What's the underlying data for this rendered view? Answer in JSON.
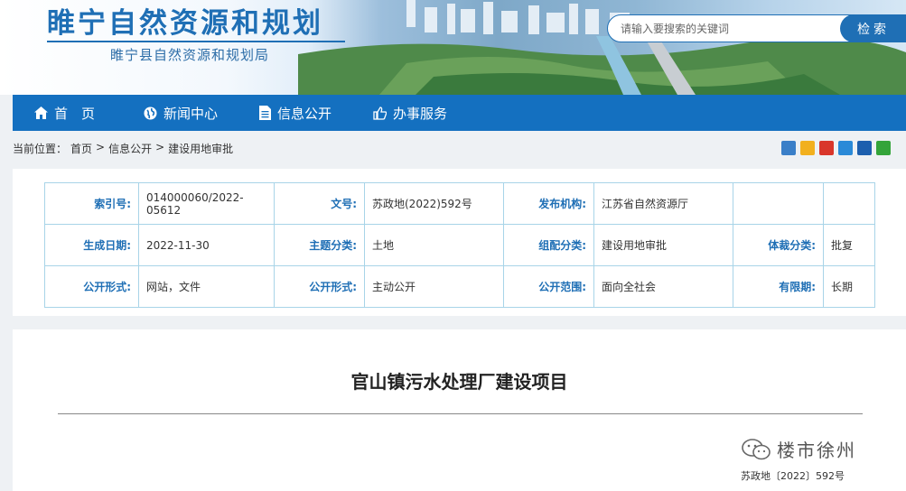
{
  "header": {
    "site_title": "睢宁自然资源和规划",
    "site_subtitle": "睢宁县自然资源和规划局",
    "search_placeholder": "请输入要搜索的关键词",
    "search_button": "检索"
  },
  "nav": [
    {
      "label": "首　页",
      "icon": "home-icon"
    },
    {
      "label": "新闻中心",
      "icon": "globe-icon"
    },
    {
      "label": "信息公开",
      "icon": "document-icon"
    },
    {
      "label": "办事服务",
      "icon": "thumbs-up-icon"
    }
  ],
  "breadcrumb": {
    "prefix": "当前位置：",
    "items": [
      "首页",
      "信息公开",
      "建设用地审批"
    ],
    "sep1": ">",
    "sep2": ">"
  },
  "share_icons": [
    {
      "name": "plus-share-icon",
      "color": "#3a7fc8"
    },
    {
      "name": "qzone-share-icon",
      "color": "#f2b01e"
    },
    {
      "name": "weibo-share-icon",
      "color": "#d9362b"
    },
    {
      "name": "tencent-share-icon",
      "color": "#2a8ad8"
    },
    {
      "name": "renren-share-icon",
      "color": "#1d5fae"
    },
    {
      "name": "wechat-share-icon",
      "color": "#34a43a"
    }
  ],
  "metadata": {
    "rows": [
      [
        {
          "label": "索引号:",
          "value": "014000060/2022-05612"
        },
        {
          "label": "文号:",
          "value": "苏政地(2022)592号"
        },
        {
          "label": "发布机构:",
          "value": "江苏省自然资源厅"
        },
        {
          "label": "",
          "value": ""
        }
      ],
      [
        {
          "label": "生成日期:",
          "value": "2022-11-30"
        },
        {
          "label": "主题分类:",
          "value": "土地"
        },
        {
          "label": "组配分类:",
          "value": "建设用地审批"
        },
        {
          "label": "体裁分类:",
          "value": "批复"
        }
      ],
      [
        {
          "label": "公开形式:",
          "value": "网站，文件"
        },
        {
          "label": "公开形式:",
          "value": "主动公开"
        },
        {
          "label": "公开范围:",
          "value": "面向全社会"
        },
        {
          "label": "有限期:",
          "value": "长期"
        }
      ]
    ]
  },
  "article": {
    "title": "官山镇污水处理厂建设项目",
    "watermark": "楼市徐州",
    "doc_number": "苏政地〔2022〕592号"
  },
  "colors": {
    "brand_blue": "#1f6fb5",
    "nav_blue": "#1470c0",
    "table_border": "#a8d4e8"
  }
}
